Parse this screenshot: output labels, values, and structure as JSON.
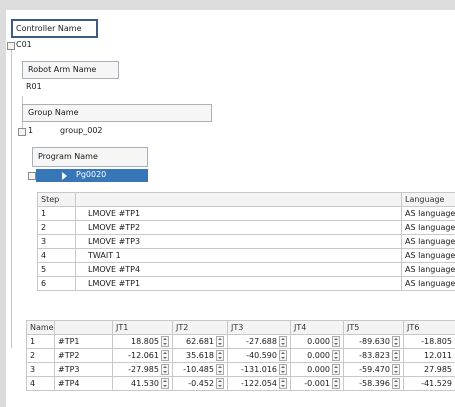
{
  "controller": {
    "header": "Controller Name",
    "value": "C01"
  },
  "robot_arm": {
    "header": "Robot Arm Name",
    "value": "R01"
  },
  "group": {
    "header": "Group Name",
    "index": "1",
    "value": "group_002"
  },
  "program": {
    "header": "Program Name",
    "selected": "Pg0020"
  },
  "steps": {
    "columns": [
      "Step",
      "",
      "Language"
    ],
    "rows": [
      {
        "step": "1",
        "command": "LMOVE #TP1",
        "language": "AS language"
      },
      {
        "step": "2",
        "command": "LMOVE #TP2",
        "language": "AS language"
      },
      {
        "step": "3",
        "command": "LMOVE #TP3",
        "language": "AS language"
      },
      {
        "step": "4",
        "command": "TWAIT 1",
        "language": "AS language"
      },
      {
        "step": "5",
        "command": "LMOVE #TP4",
        "language": "AS language"
      },
      {
        "step": "6",
        "command": "LMOVE #TP1",
        "language": "AS language"
      }
    ]
  },
  "points": {
    "columns": [
      "Name",
      "",
      "JT1",
      "JT2",
      "JT3",
      "JT4",
      "JT5",
      "JT6"
    ],
    "rows": [
      {
        "no": "1",
        "name": "#TP1",
        "jt": [
          "18.805",
          "62.681",
          "-27.688",
          "0.000",
          "-89.630",
          "-18.805"
        ]
      },
      {
        "no": "2",
        "name": "#TP2",
        "jt": [
          "-12.061",
          "35.618",
          "-40.590",
          "0.000",
          "-83.823",
          "12.011"
        ]
      },
      {
        "no": "3",
        "name": "#TP3",
        "jt": [
          "-27.985",
          "-10.485",
          "-131.016",
          "0.000",
          "-59.470",
          "27.985"
        ]
      },
      {
        "no": "4",
        "name": "#TP4",
        "jt": [
          "41.530",
          "-0.452",
          "-122.054",
          "-0.001",
          "-58.396",
          "-41.529"
        ]
      }
    ]
  }
}
